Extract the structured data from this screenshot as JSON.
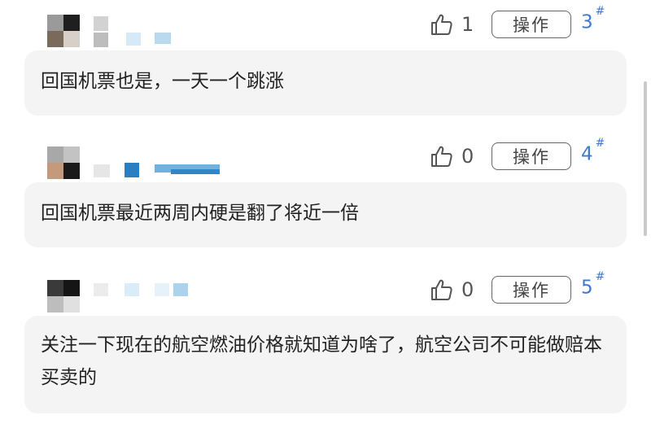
{
  "comments": [
    {
      "like_count": "1",
      "action_label": "操作",
      "floor_number": "3",
      "floor_mark": "#",
      "text": "回国机票也是，一天一个跳涨"
    },
    {
      "like_count": "0",
      "action_label": "操作",
      "floor_number": "4",
      "floor_mark": "#",
      "text": "回国机票最近两周内硬是翻了将近一倍"
    },
    {
      "like_count": "0",
      "action_label": "操作",
      "floor_number": "5",
      "floor_mark": "#",
      "text": "关注一下现在的航空燃油价格就知道为啥了，航空公司不可能做赔本买卖的"
    }
  ],
  "icons": {
    "like": "thumbs-up-icon"
  },
  "colors": {
    "floor_number": "#3e79cc",
    "bubble_background": "#f4f4f5",
    "border": "#666666"
  }
}
